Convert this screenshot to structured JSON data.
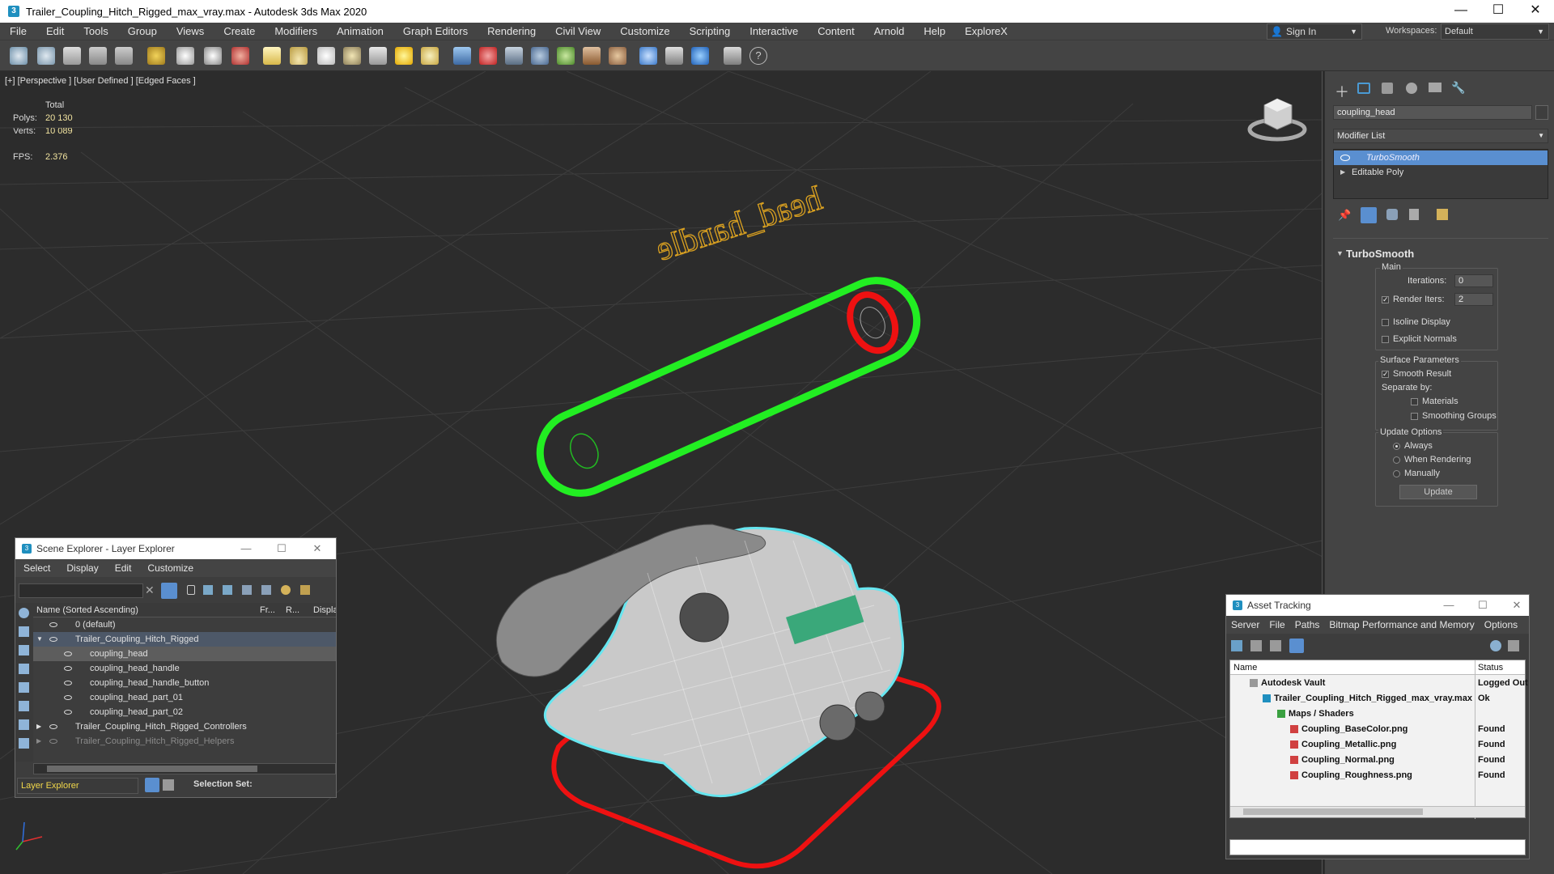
{
  "window": {
    "title": "Trailer_Coupling_Hitch_Rigged_max_vray.max - Autodesk 3ds Max 2020",
    "app_icon": "3",
    "minimize": "—",
    "maximize": "☐",
    "close": "✕"
  },
  "menubar": {
    "items": [
      "File",
      "Edit",
      "Tools",
      "Group",
      "Views",
      "Create",
      "Modifiers",
      "Animation",
      "Graph Editors",
      "Rendering",
      "Civil View",
      "Customize",
      "Scripting",
      "Interactive",
      "Content",
      "Arnold",
      "Help",
      "ExploreX"
    ],
    "sign_in": "Sign In",
    "workspaces_label": "Workspaces:",
    "workspaces_value": "Default"
  },
  "viewport": {
    "label": "[+] [Perspective ] [User Defined ] [Edged Faces ]",
    "stats": {
      "total_label": "Total",
      "polys_label": "Polys:",
      "polys_value": "20 130",
      "verts_label": "Verts:",
      "verts_value": "10 089",
      "fps_label": "FPS:",
      "fps_value": "2.376"
    },
    "shape_text": "head_handle"
  },
  "command_panel": {
    "object_name": "coupling_head",
    "modifier_list": "Modifier List",
    "stack": [
      "TurboSmooth",
      "Editable Poly"
    ],
    "rollout_title": "TurboSmooth",
    "main_label": "Main",
    "iterations_label": "Iterations:",
    "iterations_value": "0",
    "render_iters_label": "Render Iters:",
    "render_iters_value": "2",
    "isoline_label": "Isoline Display",
    "explicit_normals_label": "Explicit Normals",
    "surface_params_label": "Surface Parameters",
    "smooth_result_label": "Smooth Result",
    "separate_by_label": "Separate by:",
    "materials_label": "Materials",
    "smoothing_groups_label": "Smoothing Groups",
    "update_options_label": "Update Options",
    "always_label": "Always",
    "when_rendering_label": "When Rendering",
    "manually_label": "Manually",
    "update_button": "Update"
  },
  "scene_explorer": {
    "title": "Scene Explorer - Layer Explorer",
    "menu": [
      "Select",
      "Display",
      "Edit",
      "Customize"
    ],
    "col_name": "Name (Sorted Ascending)",
    "col_frozen": "Fr...",
    "col_render": "R...",
    "col_display": "Display",
    "rows": [
      {
        "label": "0 (default)",
        "indent": 0
      },
      {
        "label": "Trailer_Coupling_Hitch_Rigged",
        "indent": 0
      },
      {
        "label": "coupling_head",
        "indent": 1
      },
      {
        "label": "coupling_head_handle",
        "indent": 1
      },
      {
        "label": "coupling_head_handle_button",
        "indent": 1
      },
      {
        "label": "coupling_head_part_01",
        "indent": 1
      },
      {
        "label": "coupling_head_part_02",
        "indent": 1
      },
      {
        "label": "Trailer_Coupling_Hitch_Rigged_Controllers",
        "indent": 0
      },
      {
        "label": "Trailer_Coupling_Hitch_Rigged_Helpers",
        "indent": 0
      }
    ],
    "footer_mode": "Layer Explorer",
    "selection_set_label": "Selection Set:"
  },
  "asset_tracking": {
    "title": "Asset Tracking",
    "menu": [
      "Server",
      "File",
      "Paths",
      "Bitmap Performance and Memory",
      "Options"
    ],
    "col_name": "Name",
    "col_status": "Status",
    "rows": [
      {
        "name": "Autodesk Vault",
        "status": "Logged Out"
      },
      {
        "name": "Trailer_Coupling_Hitch_Rigged_max_vray.max",
        "status": "Ok"
      },
      {
        "name": "Maps / Shaders",
        "status": ""
      },
      {
        "name": "Coupling_BaseColor.png",
        "status": "Found"
      },
      {
        "name": "Coupling_Metallic.png",
        "status": "Found"
      },
      {
        "name": "Coupling_Normal.png",
        "status": "Found"
      },
      {
        "name": "Coupling_Roughness.png",
        "status": "Found"
      }
    ]
  },
  "colors": {
    "selection_blue": "#4a90d9",
    "handle_green": "#22ee22",
    "shape_red": "#ee1111",
    "wire_cyan": "#66e6f0"
  }
}
